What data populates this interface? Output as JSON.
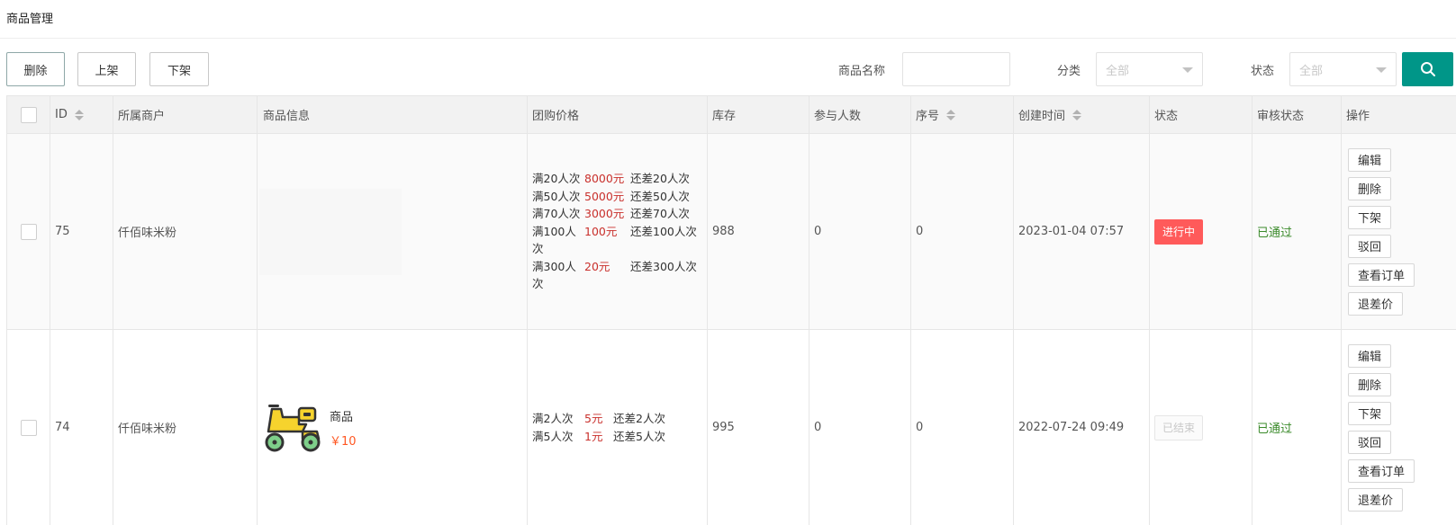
{
  "page": {
    "title": "商品管理"
  },
  "toolbar": {
    "delete_label": "删除",
    "up_label": "上架",
    "down_label": "下架"
  },
  "filters": {
    "name_label": "商品名称",
    "name_value": "",
    "category_label": "分类",
    "category_value": "全部",
    "status_label": "状态",
    "status_value": "全部",
    "search_icon": "search-icon"
  },
  "table": {
    "headers": [
      "ID",
      "所属商户",
      "商品信息",
      "团购价格",
      "库存",
      "参与人数",
      "序号",
      "创建时间",
      "状态",
      "审核状态",
      "操作"
    ],
    "rows": [
      {
        "id": "75",
        "merchant": "仟佰味米粉",
        "goods_name": "",
        "goods_price": "",
        "tiers": [
          {
            "cond": "满20人次",
            "price": "8000元",
            "remain": "还差20人次"
          },
          {
            "cond": "满50人次",
            "price": "5000元",
            "remain": "还差50人次"
          },
          {
            "cond": "满70人次",
            "price": "3000元",
            "remain": "还差70人次"
          },
          {
            "cond": "满100人次",
            "price": "100元",
            "remain": "还差100人次"
          },
          {
            "cond": "满300人次",
            "price": "20元",
            "remain": "还差300人次"
          }
        ],
        "stock": "988",
        "participants": "0",
        "seq": "0",
        "created": "2023-01-04 07:57",
        "status": "进行中",
        "audit": "已通过",
        "ops": [
          "编辑",
          "删除",
          "下架",
          "驳回",
          "查看订单",
          "退差价"
        ]
      },
      {
        "id": "74",
        "merchant": "仟佰味米粉",
        "goods_name": "商品",
        "goods_price": "￥10",
        "tiers": [
          {
            "cond": "满2人次",
            "price": "5元",
            "remain": "还差2人次"
          },
          {
            "cond": "满5人次",
            "price": "1元",
            "remain": "还差5人次"
          }
        ],
        "stock": "995",
        "participants": "0",
        "seq": "0",
        "created": "2022-07-24 09:49",
        "status": "已结束",
        "audit": "已通过",
        "ops": [
          "编辑",
          "删除",
          "下架",
          "驳回",
          "查看订单",
          "退差价"
        ]
      }
    ]
  },
  "colors": {
    "accent": "#009688",
    "status_active": "#ff5a5a",
    "audit_ok": "#3a8a2a",
    "price_red": "#c9302c",
    "goods_price": "#ff5722"
  }
}
